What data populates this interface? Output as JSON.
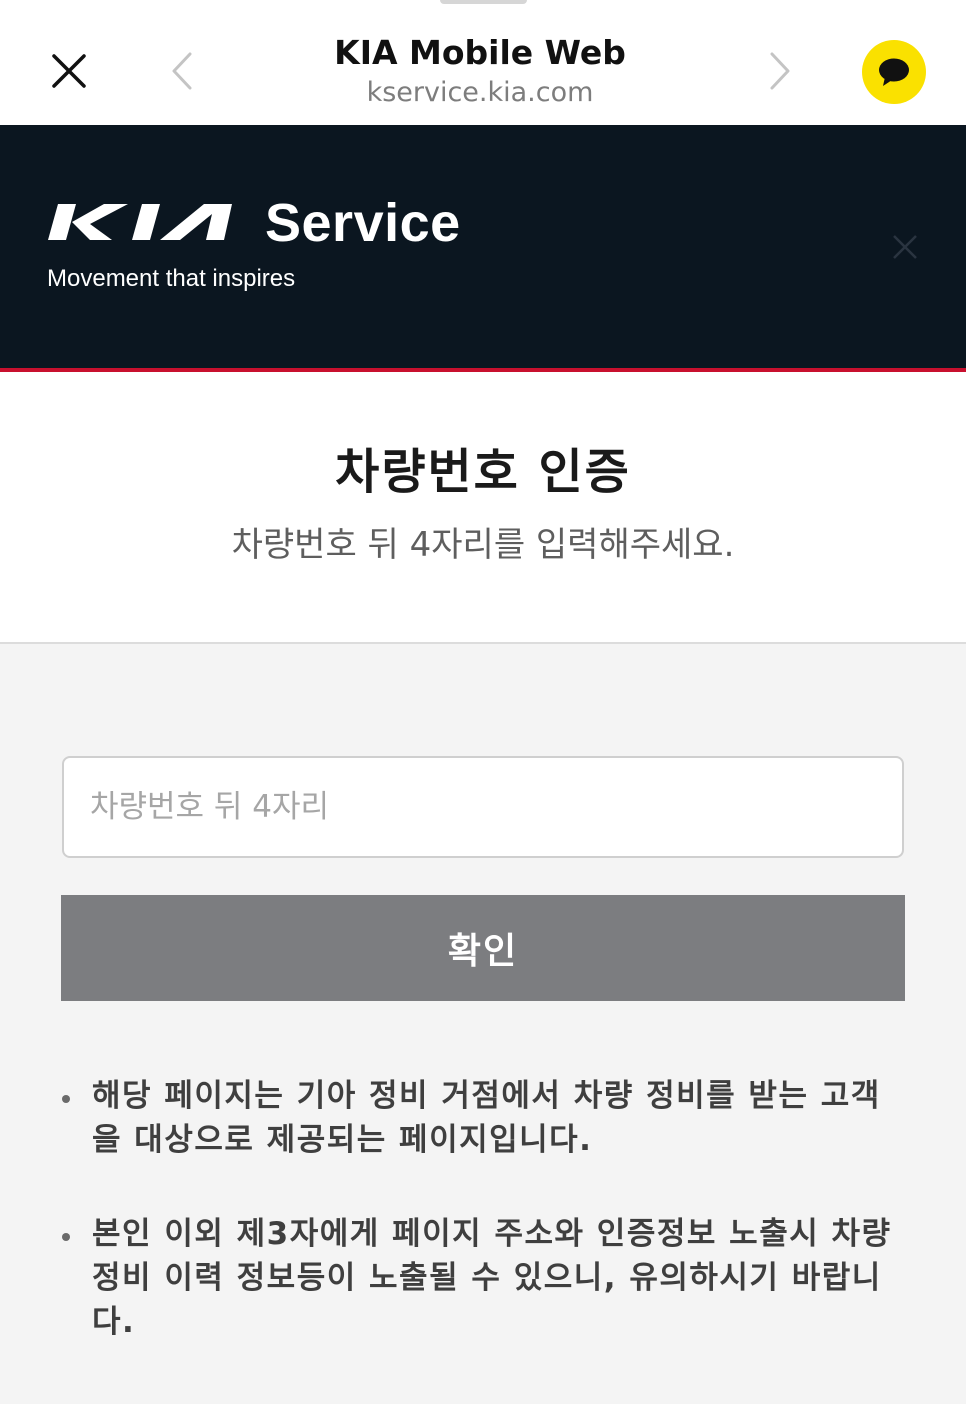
{
  "browser": {
    "title": "KIA Mobile Web",
    "url": "kservice.kia.com"
  },
  "banner": {
    "service_label": "Service",
    "tagline": "Movement that inspires",
    "background_color": "#0b1620",
    "accent_color": "#c8102e"
  },
  "main": {
    "title": "차량번호 인증",
    "subtitle": "차량번호 뒤 4자리를 입력해주세요."
  },
  "form": {
    "input_placeholder": "차량번호 뒤 4자리",
    "input_value": "",
    "confirm_label": "확인"
  },
  "notices": [
    "해당 페이지는 기아 정비 거점에서 차량 정비를 받는 고객을 대상으로 제공되는 페이지입니다.",
    "본인 이외 제3자에게 페이지 주소와 인증정보 노출시 차량정비 이력 정보등이 노출될 수 있으니, 유의하시기 바랍니다."
  ],
  "icons": {
    "close": "close-icon",
    "back": "chevron-left-icon",
    "forward": "chevron-right-icon",
    "kakao": "kakao-chat-icon",
    "banner_close": "close-icon"
  }
}
